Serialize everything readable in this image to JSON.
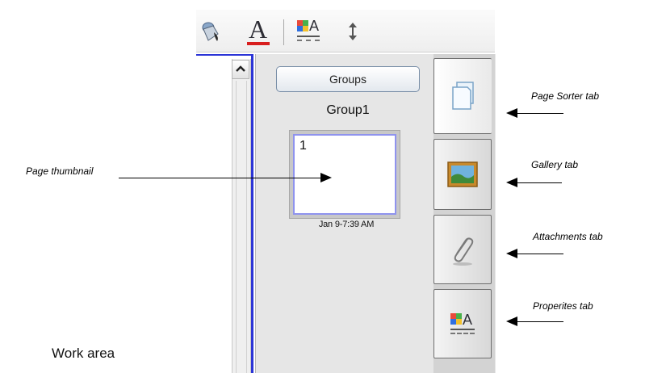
{
  "toolbar": {
    "icons": [
      "paint-bucket-icon",
      "font-color-icon",
      "properties-icon",
      "vertical-arrows-icon"
    ],
    "font_color_glyph": "A",
    "properties_glyph": "A"
  },
  "side_panel": {
    "groups_button_label": "Groups",
    "group_name": "Group1",
    "thumbnail": {
      "page_number": "1",
      "date": "Jan 9-7:39 AM"
    }
  },
  "tabs": [
    {
      "name": "page-sorter",
      "icon": "page-icon"
    },
    {
      "name": "gallery",
      "icon": "picture-icon"
    },
    {
      "name": "attachments",
      "icon": "paperclip-icon"
    },
    {
      "name": "properties",
      "icon": "properties-icon",
      "glyph": "A"
    }
  ],
  "annotations": {
    "page_thumbnail": "Page thumbnail",
    "page_sorter_tab": "Page Sorter tab",
    "gallery_tab": "Gallery tab",
    "attachments_tab": "Attachments tab",
    "properties_tab": "Properites tab",
    "work_area": "Work area"
  },
  "colors": {
    "selection_border": "#2b34d6",
    "thumbnail_border": "#8f93ee",
    "font_color_underline": "#d81e1e"
  }
}
